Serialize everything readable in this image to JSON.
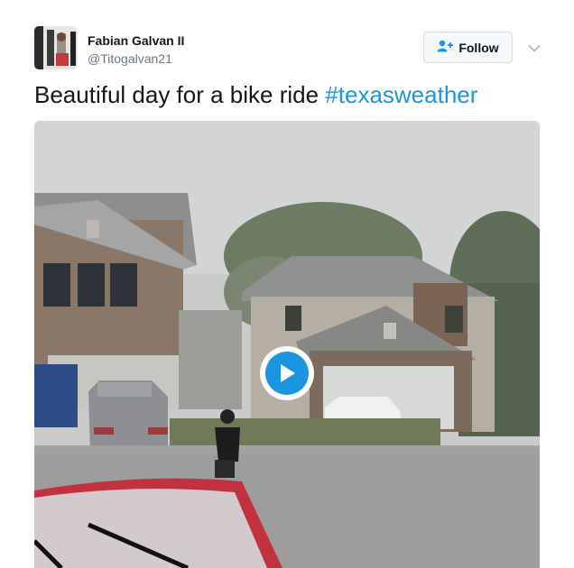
{
  "author": {
    "name": "Fabian Galvan II",
    "handle": "@Titogalvan21"
  },
  "follow": {
    "label": "Follow",
    "icon": "follow-person-plus-icon"
  },
  "menu": {
    "icon": "chevron-down-icon"
  },
  "tweet": {
    "text": "Beautiful day for a bike ride ",
    "hashtag": "#texasweather"
  },
  "media": {
    "type": "video",
    "play_icon": "play-icon"
  },
  "colors": {
    "link": "#1b95e0",
    "text": "#14171a",
    "secondary": "#657786"
  }
}
